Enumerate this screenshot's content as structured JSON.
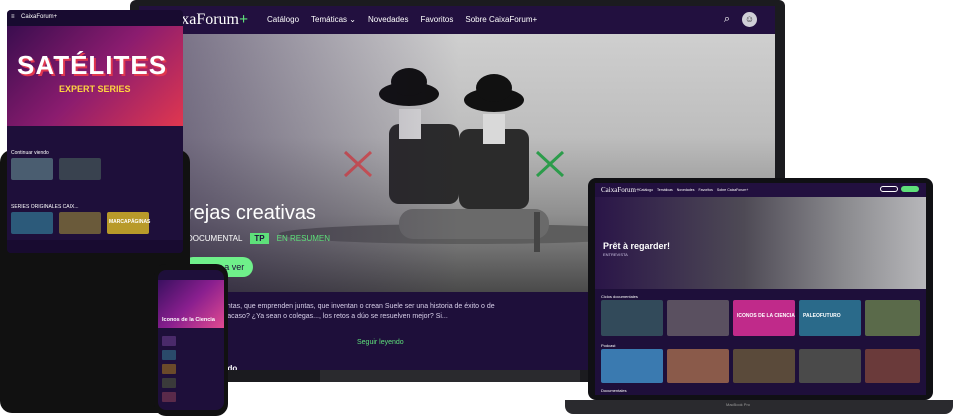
{
  "tv": {
    "logo": "CaixaForum",
    "logo_plus": "+",
    "nav": [
      "Catálogo",
      "Temáticas",
      "Novedades",
      "Favoritos",
      "Sobre CaixaForum+"
    ],
    "nav_dropdown": "⌄",
    "search_icon": "⌕",
    "avatar_icon": "☺",
    "hero_title": "rejas creativas",
    "meta_type": "DOCUMENTAL",
    "meta_tag": "TP",
    "meta_summary": "EN RESUMEN",
    "cta": "mpezar a ver",
    "description": "untas, que emprenden juntas, que inventan o crean Suele ser una historia de éxito o de fracaso? ¿Ya sean o colegas..., los retos a dúo se resuelven mejor? Si...",
    "read_more": "Seguir leyendo",
    "section": "ado"
  },
  "tablet": {
    "logo": "CaixaForum+",
    "hero_title": "SATÉLITES",
    "hero_sub": "EXPERT SERIES",
    "continue_label": "Continuar viendo",
    "originals_label": "SERIES ORIGINALES CAIX...",
    "thumb_caption": "MARCAPÁGINAS"
  },
  "phone": {
    "title": "Iconos de la Ciencia"
  },
  "laptop": {
    "logo": "CaixaForum+",
    "nav": [
      "Catálogo",
      "Temáticas",
      "Novedades",
      "Favoritos",
      "Sobre CaixaForum+"
    ],
    "hero_title": "Prêt à regarder!",
    "hero_sub": "ENTREVISTA",
    "section1": "Ciclos documentales",
    "section2": "Podcast",
    "section3": "Documentales",
    "thumb_captions": [
      "ICONOS DE LA CIENCIA",
      "PALEOFUTURO"
    ],
    "brand": "MacBook Pro"
  }
}
